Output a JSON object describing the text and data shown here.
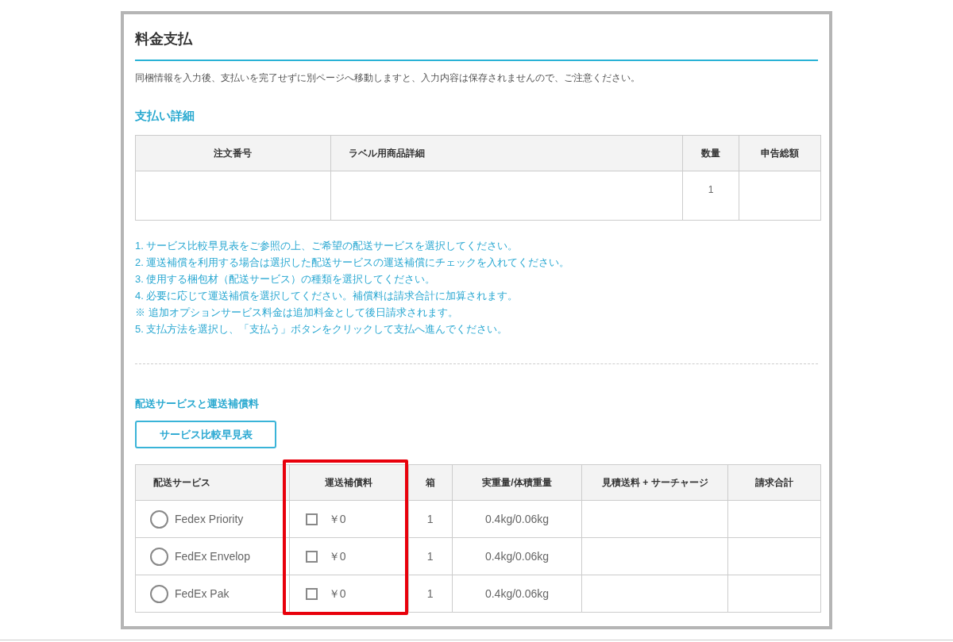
{
  "title": "料金支払",
  "notice": "同梱情報を入力後、支払いを完了せずに別ページへ移動しますと、入力内容は保存されませんので、ご注意ください。",
  "details": {
    "heading": "支払い詳細",
    "columns": [
      "注文番号",
      "ラベル用商品詳細",
      "数量",
      "申告総額"
    ],
    "rows": [
      [
        "",
        "",
        "1",
        ""
      ]
    ]
  },
  "instructions": [
    "1. サービス比較早見表をご参照の上、ご希望の配送サービスを選択してください。",
    "2. 運送補償を利用する場合は選択した配送サービスの運送補償にチェックを入れてください。",
    "3. 使用する梱包材（配送サービス）の種類を選択してください。",
    "4. 必要に応じて運送補償を選択してください。補償料は請求合計に加算されます。",
    "※ 追加オプションサービス料金は追加料金として後日請求されます。",
    "5. 支払方法を選択し、「支払う」ボタンをクリックして支払へ進んでください。"
  ],
  "shipping": {
    "heading": "配送サービスと運送補償料",
    "compare_button": "サービス比較早見表",
    "columns": [
      "配送サービス",
      "運送補償料",
      "箱",
      "実重量/体積重量",
      "見積送料 + サーチャージ",
      "請求合計"
    ],
    "rows": [
      {
        "service": "Fedex Priority",
        "selected": false,
        "insurance_checked": false,
        "insurance": "￥0",
        "boxes": "1",
        "weight": "0.4kg/0.06kg"
      },
      {
        "service": "FedEx Envelop",
        "selected": false,
        "insurance_checked": false,
        "insurance": "￥0",
        "boxes": "1",
        "weight": "0.4kg/0.06kg"
      },
      {
        "service": "FedEx Pak",
        "selected": false,
        "insurance_checked": false,
        "insurance": "￥0",
        "boxes": "1",
        "weight": "0.4kg/0.06kg"
      }
    ]
  }
}
